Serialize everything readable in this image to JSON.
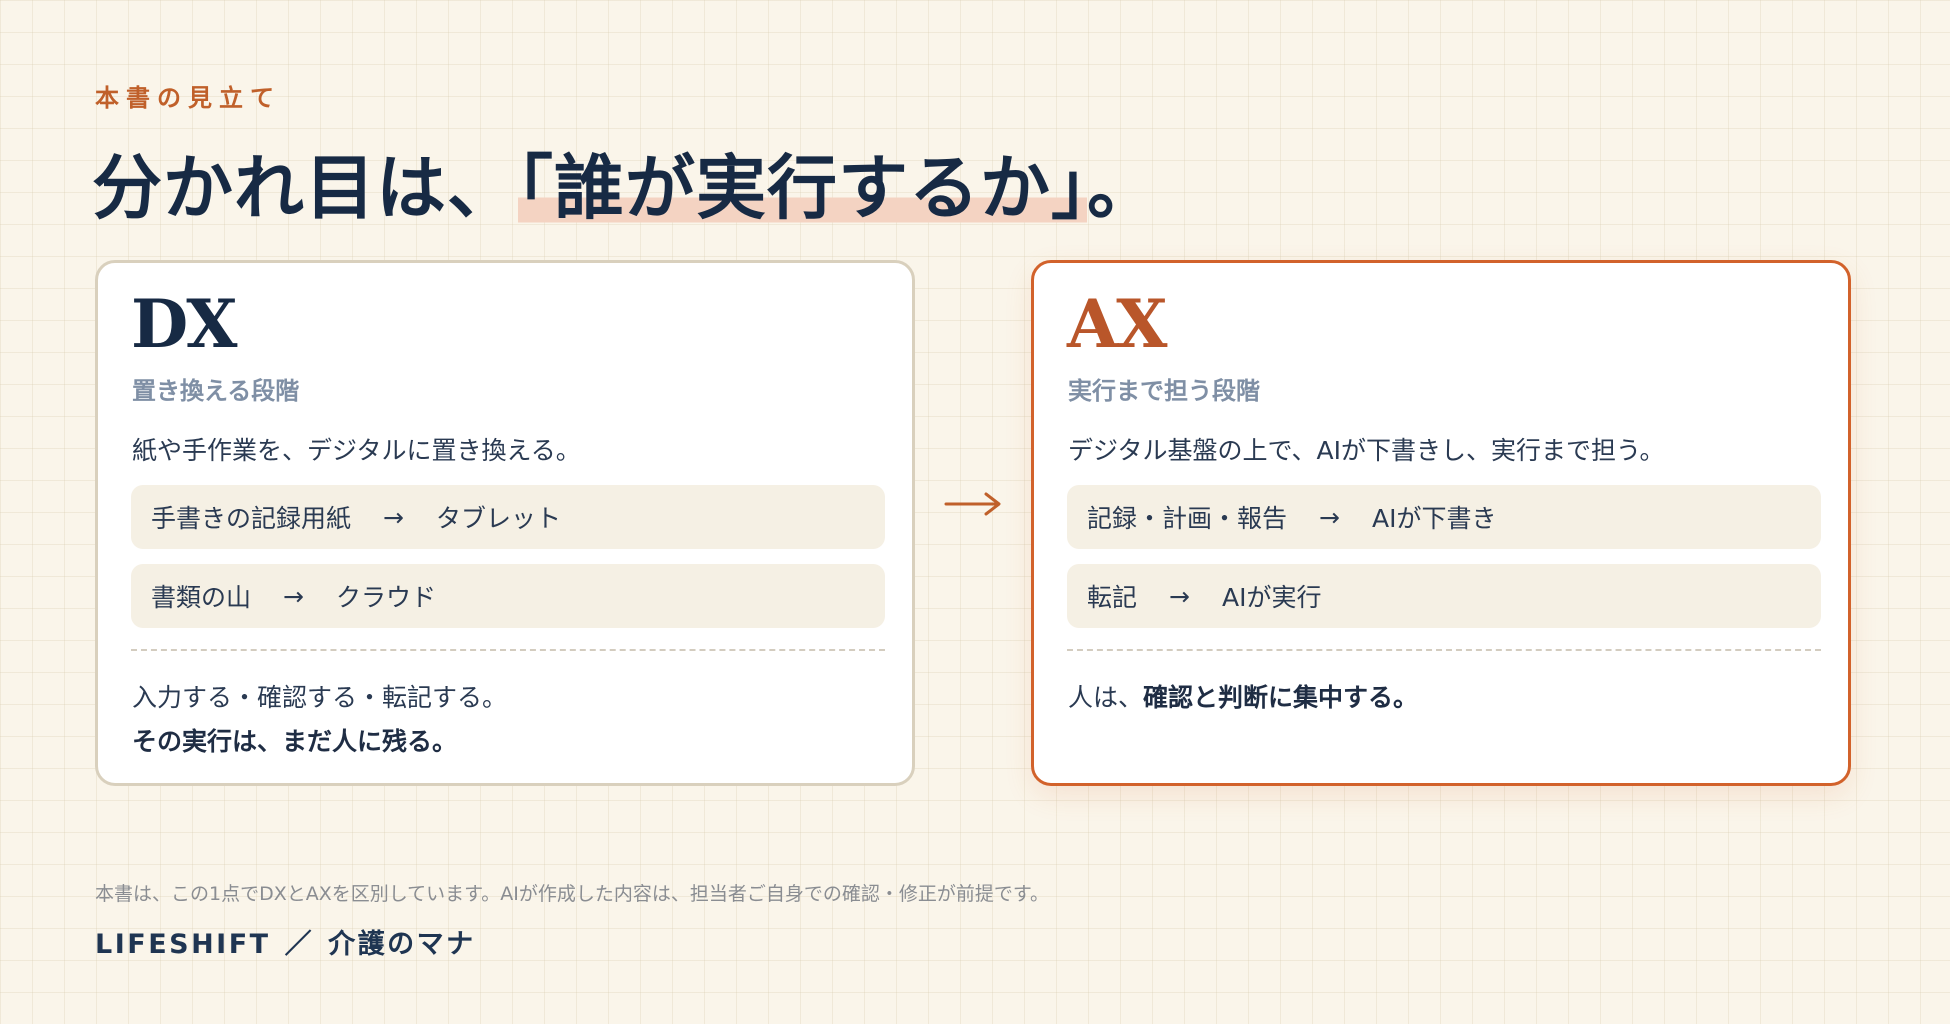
{
  "eyebrow": "本書の見立て",
  "headline": {
    "pre": "分かれ目は、",
    "highlight": "「誰が実行するか」",
    "post": "。"
  },
  "dx": {
    "title": "DX",
    "subtitle": "置き換える段階",
    "description": "紙や手作業を、デジタルに置き換える。",
    "rows": [
      {
        "from": "手書きの記録用紙",
        "arrow": "→",
        "to": "タブレット"
      },
      {
        "from": "書類の山",
        "arrow": "→",
        "to": "クラウド"
      }
    ],
    "note_line1": "入力する・確認する・転記する。",
    "note_line2": "その実行は、まだ人に残る。"
  },
  "ax": {
    "title": "AX",
    "subtitle": "実行まで担う段階",
    "description": "デジタル基盤の上で、AIが下書きし、実行まで担う。",
    "rows": [
      {
        "from": "記録・計画・報告",
        "arrow": "→",
        "to": "AIが下書き"
      },
      {
        "from": "転記",
        "arrow": "→",
        "to": "AIが実行"
      }
    ],
    "note_pre": "人は、",
    "note_bold": "確認と判断に集中する。"
  },
  "footer": {
    "note": "本書は、この1点でDXとAXを区別しています。AIが作成した内容は、担当者ご自身での確認・修正が前提です。",
    "brand_left": "LIFESHIFT",
    "brand_sep": "／",
    "brand_right": "介護のマナ"
  },
  "colors": {
    "background": "#faf5ea",
    "accent": "#c0602a",
    "navy": "#172a44",
    "ax_border": "#d2622b",
    "dx_border": "#d9d0bd",
    "row_bg": "#f5f0e4",
    "highlight": "#f4d3c2"
  },
  "icons": {
    "flow_arrow": "arrow-right-icon"
  }
}
